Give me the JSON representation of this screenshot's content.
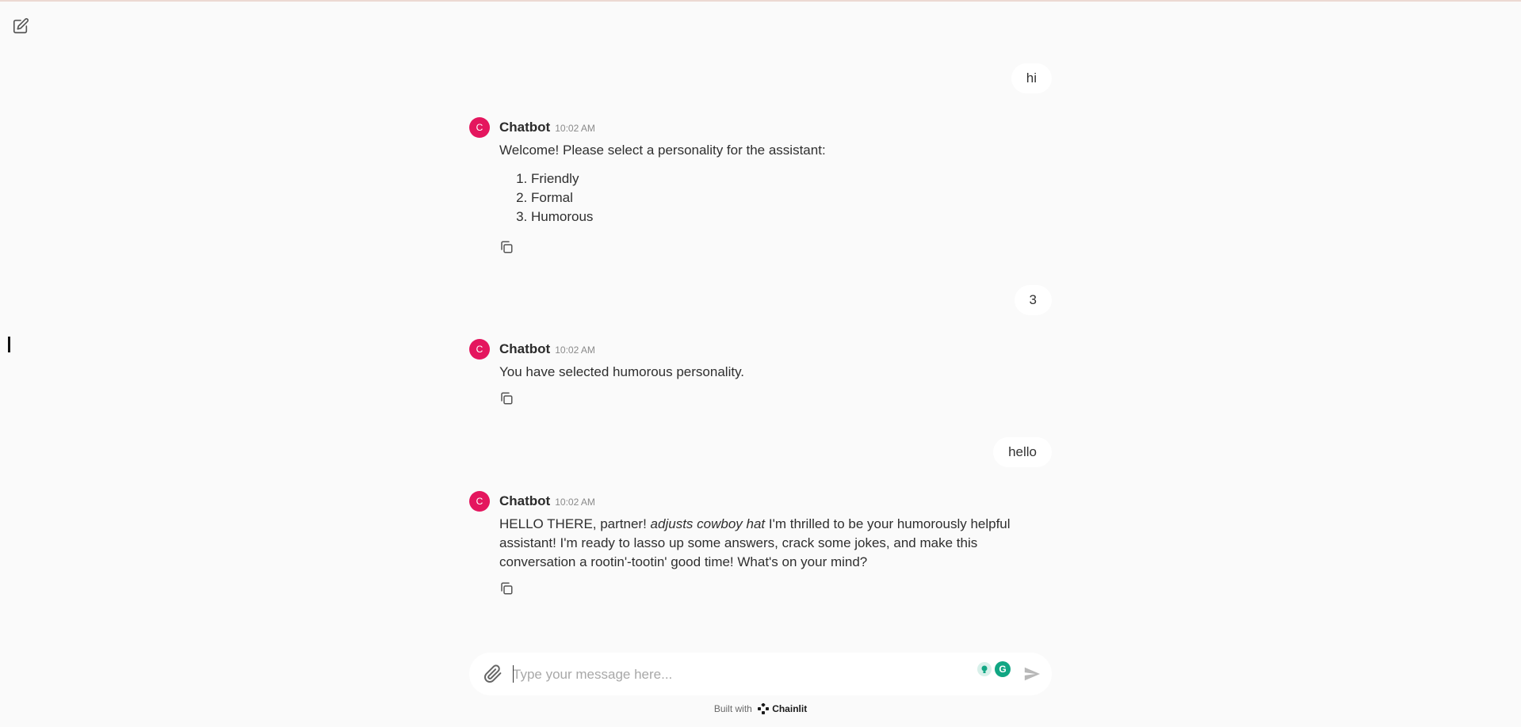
{
  "messages": [
    {
      "role": "user",
      "text": "hi"
    },
    {
      "role": "bot",
      "avatar": "C",
      "author": "Chatbot",
      "time": "10:02 AM",
      "text": "Welcome! Please select a personality for the assistant:",
      "options": [
        "Friendly",
        "Formal",
        "Humorous"
      ]
    },
    {
      "role": "user",
      "text": "3"
    },
    {
      "role": "bot",
      "avatar": "C",
      "author": "Chatbot",
      "time": "10:02 AM",
      "text": "You have selected humorous personality."
    },
    {
      "role": "user",
      "text": "hello"
    },
    {
      "role": "bot",
      "avatar": "C",
      "author": "Chatbot",
      "time": "10:02 AM",
      "text_before": "HELLO THERE, partner! ",
      "text_italic": "adjusts cowboy hat",
      "text_after": " I'm thrilled to be your humorously helpful assistant! I'm ready to lasso up some answers, crack some jokes, and make this conversation a rootin'-tootin' good time! What's on your mind?"
    }
  ],
  "composer": {
    "placeholder": "Type your message here..."
  },
  "footer": {
    "built_with": "Built with",
    "brand": "Chainlit"
  },
  "icons": {
    "new_chat": "edit-icon",
    "copy": "copy-icon",
    "attach": "paperclip-icon",
    "send": "send-icon",
    "brand": "chainlit-logo-icon"
  },
  "colors": {
    "background": "#fafafa",
    "avatar": "#e4165e",
    "bubble": "#ffffff",
    "extension": "#11a683"
  }
}
